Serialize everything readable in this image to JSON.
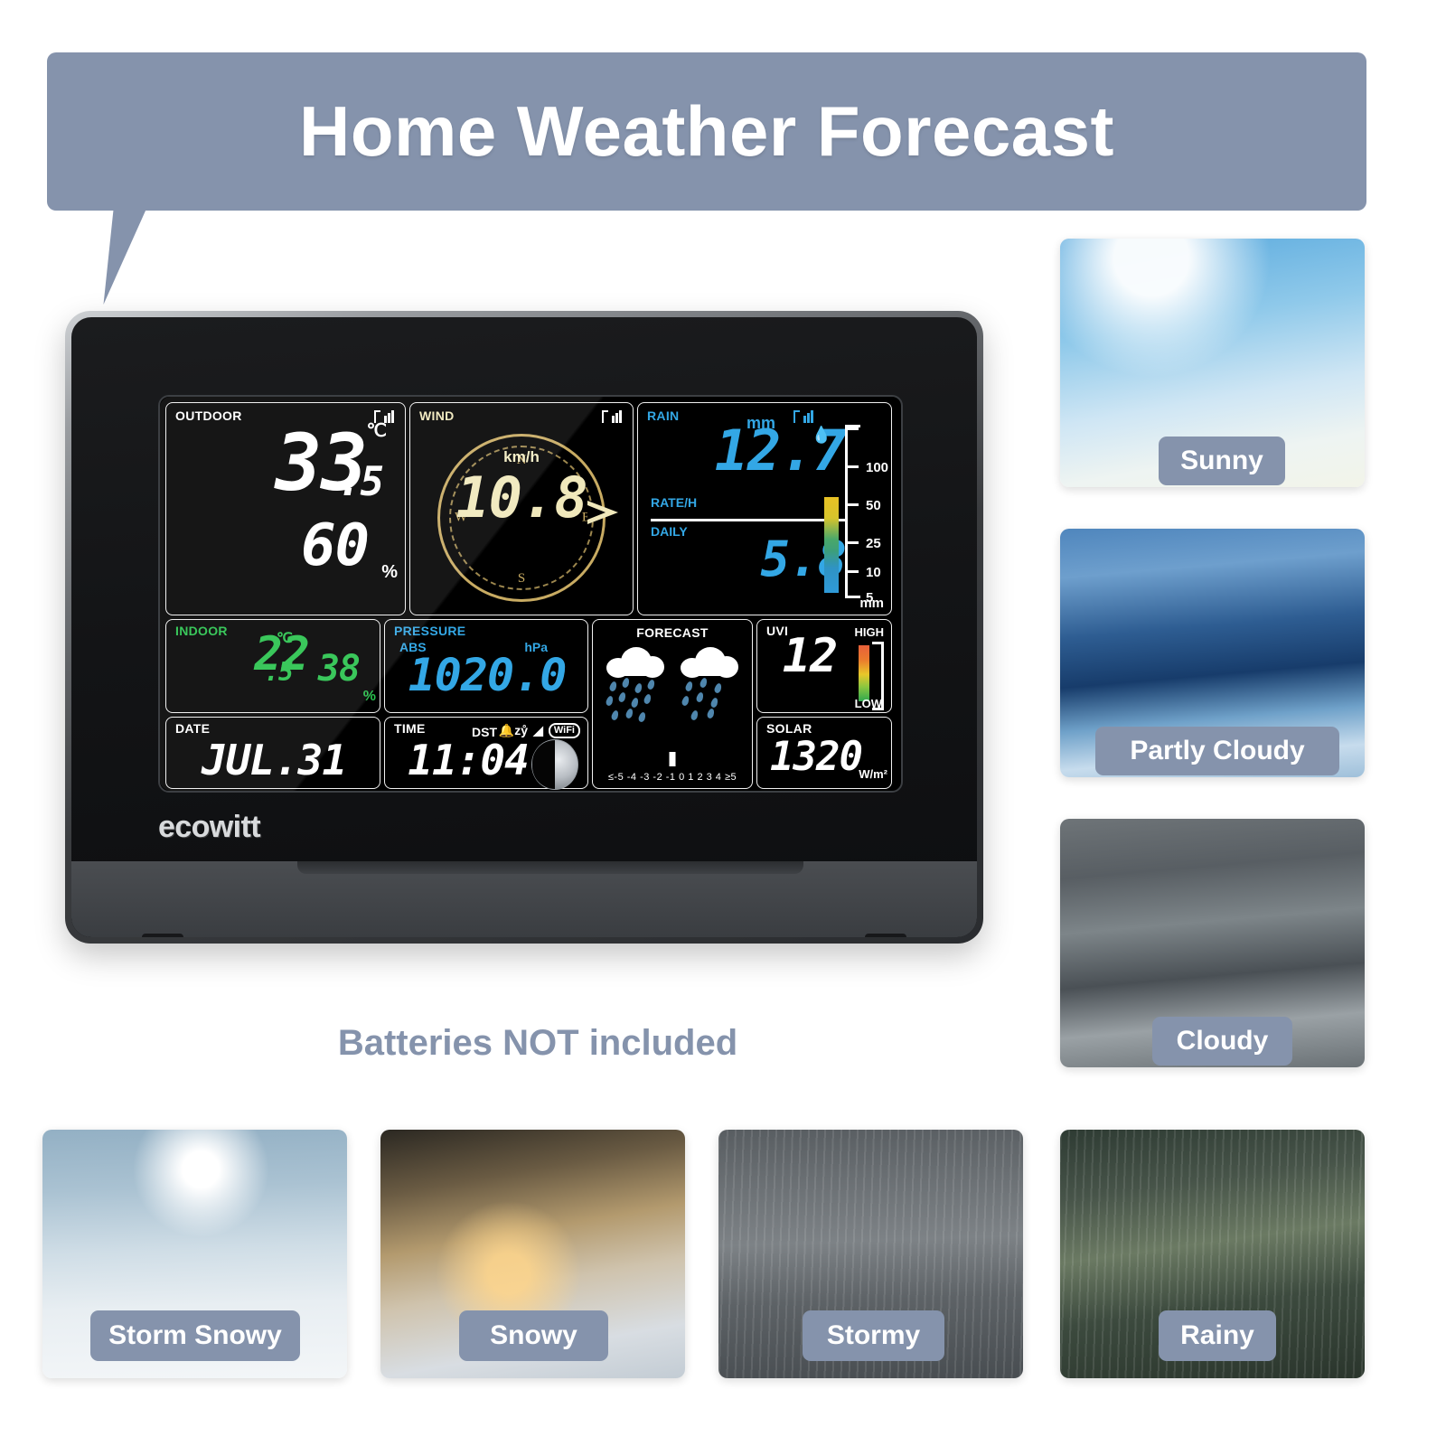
{
  "banner": {
    "title": "Home Weather Forecast",
    "bg_color": "#8593ac"
  },
  "caption": {
    "batteries": "Batteries NOT included"
  },
  "device": {
    "brand": "ecowitt",
    "lcd": {
      "outdoor": {
        "label": "OUTDOOR",
        "temp": "33",
        "temp_decimal": ".5",
        "temp_unit": "℃",
        "humidity": "60",
        "humidity_unit": "%",
        "signal_icon": "signal-bars-icon",
        "color": "#ffffff"
      },
      "wind": {
        "label": "WIND",
        "unit": "km/h",
        "value": "10.8",
        "direction": "E",
        "compass": {
          "n": "N",
          "e": "E",
          "s": "S",
          "w": "W"
        },
        "signal_icon": "signal-bars-icon",
        "color": "#f0e8bb"
      },
      "rain": {
        "label": "RAIN",
        "unit": "mm",
        "rate_label": "RATE/H",
        "rate_value": "12.7",
        "daily_label": "DAILY",
        "daily_value": "5.8",
        "scale_ticks": [
          "100",
          "50",
          "25",
          "10",
          "5"
        ],
        "scale_unit": "mm",
        "drop_icon": "rain-drop-icon",
        "signal_icon": "signal-bars-icon",
        "color": "#33a7e5"
      },
      "indoor": {
        "label": "INDOOR",
        "temp": "22",
        "temp_decimal": ".5",
        "temp_unit": "℃",
        "humidity": "38",
        "humidity_unit": "%",
        "color": "#27c24c"
      },
      "pressure": {
        "label": "PRESSURE",
        "mode": "ABS",
        "unit": "hPa",
        "value": "1020.0",
        "color": "#33a7e5"
      },
      "date": {
        "label": "DATE",
        "value": "JUL.31"
      },
      "time": {
        "label": "TIME",
        "value": "11:04",
        "dst": "DST",
        "alarm_icon": "alarm-snooze-icon",
        "rf_icon": "wifi-signal-icon",
        "wifi_badge": "WiFi",
        "moon_icon": "moon-phase-icon"
      },
      "forecast": {
        "label": "FORECAST",
        "icons": [
          "rainy-cloud-icon",
          "rainy-cloud-icon"
        ],
        "trend_scale": "≤-5 -4 -3 -2 -1 0 1 2 3 4 ≥5",
        "trend_marker": "0"
      },
      "uvi": {
        "label": "UVI",
        "value": "12",
        "high_label": "HIGH",
        "low_label": "LOW"
      },
      "solar": {
        "label": "SOLAR",
        "value": "1320",
        "unit": "W/m²"
      }
    }
  },
  "photos": {
    "right_column": [
      {
        "id": "sunny",
        "label": "Sunny"
      },
      {
        "id": "partly-cloudy",
        "label": "Partly Cloudy"
      },
      {
        "id": "cloudy",
        "label": "Cloudy"
      }
    ],
    "bottom_row": [
      {
        "id": "storm-snowy",
        "label": "Storm Snowy"
      },
      {
        "id": "snowy",
        "label": "Snowy"
      },
      {
        "id": "stormy",
        "label": "Stormy"
      },
      {
        "id": "rainy",
        "label": "Rainy"
      }
    ]
  }
}
